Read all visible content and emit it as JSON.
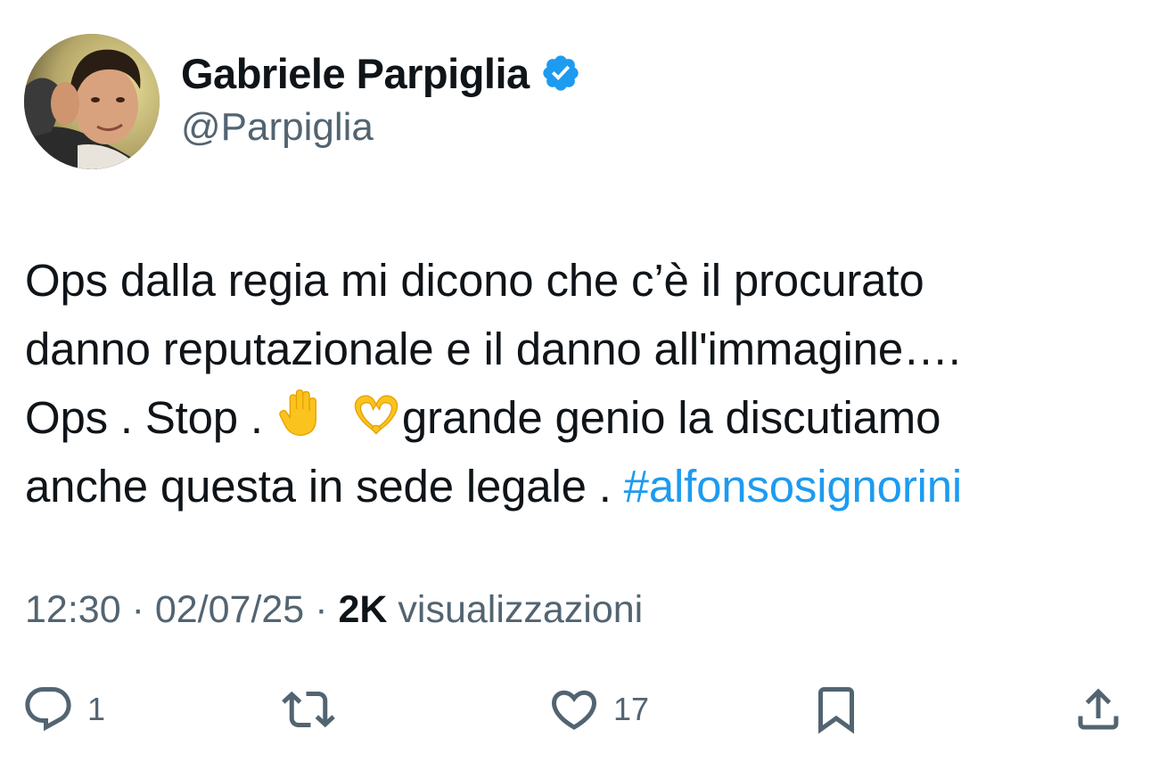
{
  "author": {
    "display_name": "Gabriele Parpiglia",
    "handle": "@Parpiglia",
    "verified_color": "#1d9bf0"
  },
  "tweet": {
    "line1": "Ops dalla regia mi dicono che c’è il procurato",
    "line2": "danno reputazionale e il danno all'immagine….",
    "line3_a": "Ops . Stop . ",
    "emoji_1": "raised-hand-emoji",
    "emoji_2": "heart-hands-emoji",
    "line3_b": "grande genio la discutiamo",
    "line4": "anche questa in sede legale . ",
    "hashtag": "#alfonsosignorini"
  },
  "meta": {
    "time": "12:30",
    "date": "02/07/25",
    "views_count": "2K",
    "views_label": "visualizzazioni"
  },
  "actions": {
    "reply_count": "1",
    "retweet_count": "",
    "like_count": "17"
  },
  "colors": {
    "text": "#0f1419",
    "secondary": "#536471",
    "accent": "#1d9bf0"
  }
}
